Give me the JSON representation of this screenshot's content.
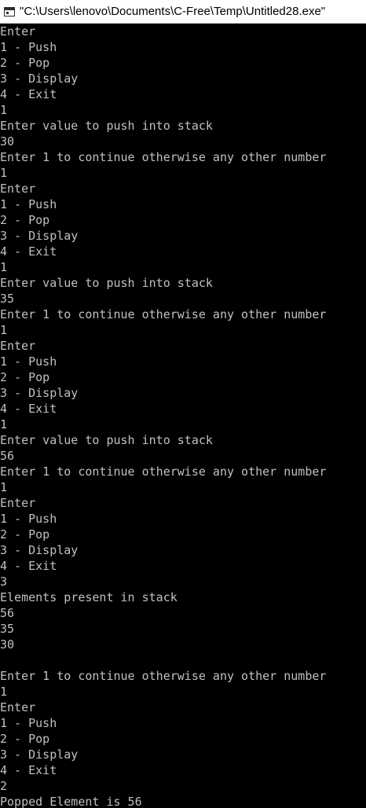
{
  "window": {
    "title": "\"C:\\Users\\lenovo\\Documents\\C-Free\\Temp\\Untitled28.exe\"",
    "icon": "console-window-icon",
    "colors": {
      "titlebar_bg": "#ffffff",
      "console_bg": "#000000",
      "console_text": "#c0c0c0"
    }
  },
  "console": {
    "lines": [
      "Enter",
      "1 - Push",
      "2 - Pop",
      "3 - Display",
      "4 - Exit",
      "1",
      "Enter value to push into stack",
      "30",
      "Enter 1 to continue otherwise any other number",
      "1",
      "Enter",
      "1 - Push",
      "2 - Pop",
      "3 - Display",
      "4 - Exit",
      "1",
      "Enter value to push into stack",
      "35",
      "Enter 1 to continue otherwise any other number",
      "1",
      "Enter",
      "1 - Push",
      "2 - Pop",
      "3 - Display",
      "4 - Exit",
      "1",
      "Enter value to push into stack",
      "56",
      "Enter 1 to continue otherwise any other number",
      "1",
      "Enter",
      "1 - Push",
      "2 - Pop",
      "3 - Display",
      "4 - Exit",
      "3",
      "Elements present in stack",
      "56",
      "35",
      "30",
      "",
      "Enter 1 to continue otherwise any other number",
      "1",
      "Enter",
      "1 - Push",
      "2 - Pop",
      "3 - Display",
      "4 - Exit",
      "2",
      "Popped Element is 56"
    ]
  }
}
